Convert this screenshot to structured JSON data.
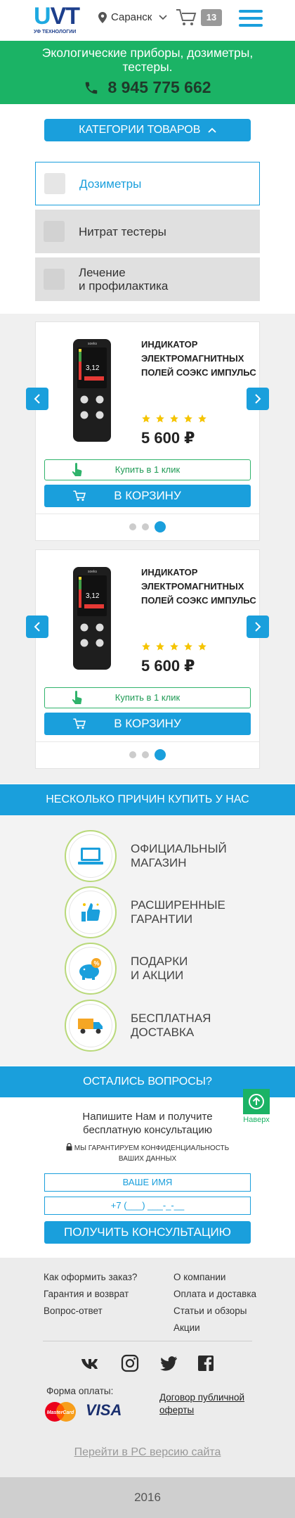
{
  "header": {
    "logo_text": "UVT",
    "logo_sub": "УФ ТЕХНОЛОГИИ",
    "city": "Саранск",
    "cart_count": "13",
    "icons": [
      "location-pin-icon",
      "chevron-down-icon",
      "cart-icon",
      "menu-icon"
    ]
  },
  "banner": {
    "tagline": "Экологические приборы, дозиметры, тестеры.",
    "phone": "8 945 775 662",
    "color": "#1bb365"
  },
  "categories": {
    "button_label": "Категории товаров",
    "items": [
      {
        "label": "Дозиметры",
        "active": true
      },
      {
        "label": "Нитрат тестеры",
        "active": false
      },
      {
        "label": "Лечение\nи профилактика",
        "active": false
      }
    ]
  },
  "products": [
    {
      "name": "Индикатор электромагнитных полей СОЭКС ИМПУЛЬС",
      "rating": 5,
      "price": "5 600 ₽",
      "one_click_label": "Купить в 1 клик",
      "cart_label": "В корзину",
      "screen_value": "3,12",
      "slide_count": 3,
      "active_slide": 3
    },
    {
      "name": "Индикатор электромагнитных полей СОЭКС ИМПУЛЬС",
      "rating": 5,
      "price": "5 600 ₽",
      "one_click_label": "Купить в 1 клик",
      "cart_label": "В корзину",
      "screen_value": "3,12",
      "slide_count": 3,
      "active_slide": 3
    }
  ],
  "reasons": {
    "title": "Несколько причин купить у нас",
    "items": [
      {
        "label": "Официальный\nмагазин",
        "icon": "laptop-icon"
      },
      {
        "label": "Расширенные\nгарантии",
        "icon": "thumbs-up-icon"
      },
      {
        "label": "Подарки\nи акции",
        "icon": "piggy-bank-icon"
      },
      {
        "label": "Бесплатная\nдоставка",
        "icon": "delivery-truck-icon"
      }
    ]
  },
  "questions": {
    "title": "Остались вопросы?",
    "lead": "Напишите Нам и получите бесплатную консультацию",
    "guarantee": "Мы гарантируем конфиденциальность ваших данных",
    "name_placeholder": "ВАШЕ ИМЯ",
    "phone_placeholder": "+7 (___) ___-_-__",
    "submit_label": "Получить консультацию",
    "to_top_label": "Наверх"
  },
  "footer": {
    "col1": [
      "Как оформить заказ?",
      "Гарантия и возврат",
      "Вопрос-ответ"
    ],
    "col2": [
      "О компании",
      "Оплата и доставка",
      "Статьи и обзоры",
      "Акции"
    ],
    "social": [
      "vk-icon",
      "instagram-icon",
      "twitter-icon",
      "facebook-icon"
    ],
    "payment_label": "Форма оплаты:",
    "mastercard_label": "MasterCard",
    "visa_label": "VISA",
    "offer_link": "Договор публичной оферты",
    "pc_link": "Перейти в PC версию сайта",
    "copyright": "2016"
  },
  "colors": {
    "accent": "#1a9fdc",
    "green": "#1bb365",
    "star": "#f5c400"
  }
}
